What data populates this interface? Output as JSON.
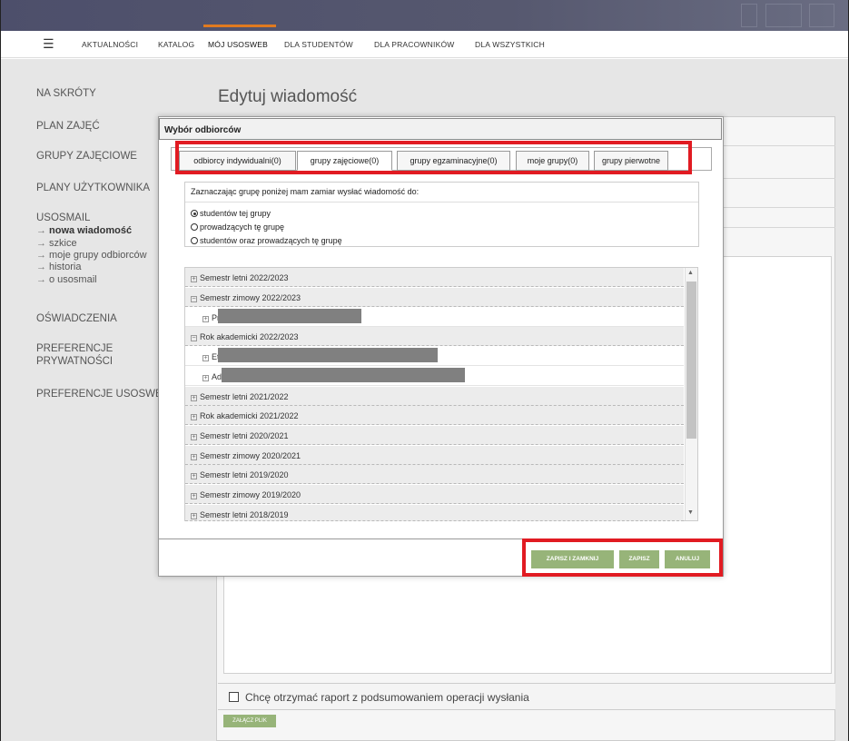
{
  "nav": {
    "items": [
      "AKTUALNOŚCI",
      "KATALOG",
      "MÓJ USOSWEB",
      "DLA STUDENTÓW",
      "DLA PRACOWNIKÓW",
      "DLA WSZYSTKICH"
    ]
  },
  "sidebar": {
    "na_skroty": "NA SKRÓTY",
    "plan_zajec": "PLAN ZAJĘĆ",
    "grupy_zajeciowe": "GRUPY ZAJĘCIOWE",
    "plany_uzytkownika": "PLANY UŻYTKOWNIKA",
    "usosmail": "USOSMAIL",
    "usosmail_sub": [
      "nowa wiadomość",
      "szkice",
      "moje grupy odbiorców",
      "historia",
      "o usosmail"
    ],
    "oswiadczenia": "OŚWIADCZENIA",
    "preferencje_prywatnosci_1": "PREFERENCJE",
    "preferencje_prywatnosci_2": "PRYWATNOŚCI",
    "preferencje_usosweb": "PREFERENCJE USOSWEB"
  },
  "page": {
    "title": "Edytuj wiadomość",
    "report_label": "Chcę otrzymać raport z podsumowaniem operacji wysłania",
    "attach_label": "ZAŁĄCZ PLIK"
  },
  "modal": {
    "title": "Wybór odbiorców",
    "tabs": [
      "odbiorcy indywidualni(0)",
      "grupy zajęciowe(0)",
      "grupy egzaminacyjne(0)",
      "moje grupy(0)",
      "grupy pierwotne"
    ],
    "option_header": "Zaznaczając grupę poniżej mam zamiar wysłać wiadomość do:",
    "options": [
      "studentów tej grupy",
      "prowadzących tę grupę",
      "studentów oraz prowadzących tę grupę"
    ],
    "tree": {
      "sem_letni_2223": "Semestr letni 2022/2023",
      "sem_zimowy_2223": "Semestr zimowy 2022/2023",
      "child_prz": "Prz",
      "rok_2223": "Rok akademicki 2022/2023",
      "child_et": "Et",
      "child_ad": "Ad",
      "sem_letni_2122": "Semestr letni 2021/2022",
      "rok_2122": "Rok akademicki 2021/2022",
      "sem_letni_2021": "Semestr letni 2020/2021",
      "sem_zimowy_2021": "Semestr zimowy 2020/2021",
      "sem_letni_1920": "Semestr letni 2019/2020",
      "sem_zimowy_1920": "Semestr zimowy 2019/2020",
      "sem_letni_1819": "Semestr letni 2018/2019"
    },
    "buttons": {
      "save_close": "ZAPISZ I ZAMKNIJ",
      "save": "ZAPISZ",
      "cancel": "ANULUJ"
    }
  },
  "colors": {
    "accent_orange": "#e07a1f",
    "button_green": "#97b479",
    "highlight_red": "#e11b22"
  }
}
